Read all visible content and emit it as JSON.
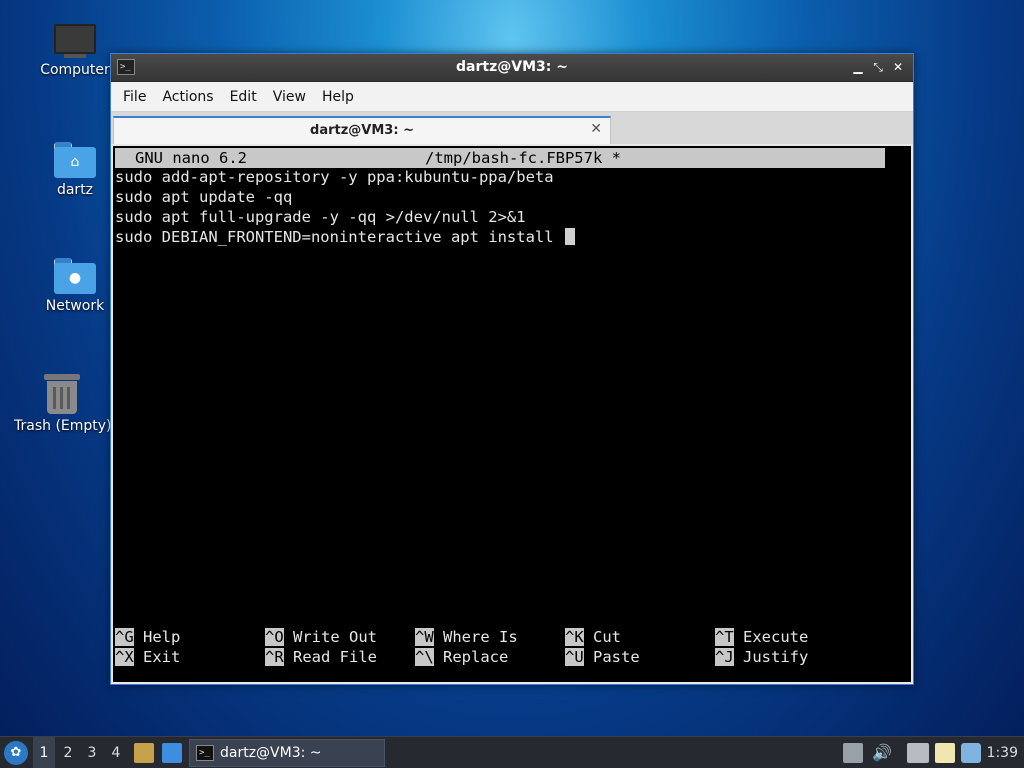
{
  "desktop": {
    "icons": [
      {
        "label": "Computer"
      },
      {
        "label": "dartz"
      },
      {
        "label": "Network"
      },
      {
        "label": "Trash (Empty)"
      }
    ]
  },
  "window": {
    "title": "dartz@VM3: ~",
    "menu": [
      "File",
      "Actions",
      "Edit",
      "View",
      "Help"
    ],
    "tab_label": "dartz@VM3: ~"
  },
  "nano": {
    "version": "GNU nano 6.2",
    "filename": "/tmp/bash-fc.FBP57k *",
    "lines": [
      "sudo add-apt-repository -y ppa:kubuntu-ppa/beta",
      "sudo apt update -qq",
      "sudo apt full-upgrade -y -qq >/dev/null 2>&1",
      "sudo DEBIAN_FRONTEND=noninteractive apt install "
    ],
    "shortcuts": [
      {
        "key": "^G",
        "label": "Help"
      },
      {
        "key": "^O",
        "label": "Write Out"
      },
      {
        "key": "^W",
        "label": "Where Is"
      },
      {
        "key": "^K",
        "label": "Cut"
      },
      {
        "key": "^T",
        "label": "Execute"
      },
      {
        "key": "^X",
        "label": "Exit"
      },
      {
        "key": "^R",
        "label": "Read File"
      },
      {
        "key": "^\\",
        "label": "Replace"
      },
      {
        "key": "^U",
        "label": "Paste"
      },
      {
        "key": "^J",
        "label": "Justify"
      }
    ]
  },
  "taskbar": {
    "workspaces": [
      "1",
      "2",
      "3",
      "4"
    ],
    "task_label": "dartz@VM3: ~",
    "clock": "1:39"
  }
}
